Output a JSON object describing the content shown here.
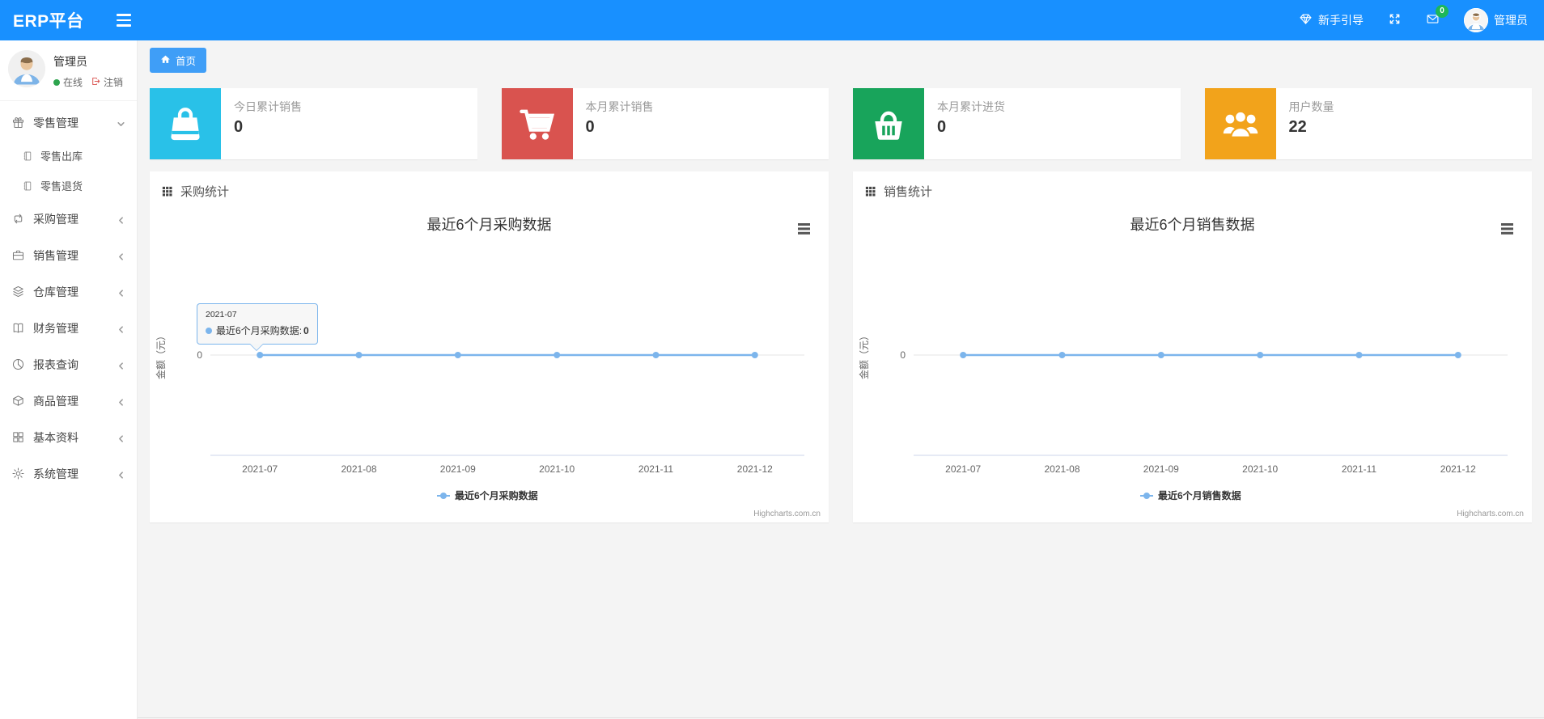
{
  "navbar": {
    "brand": "ERP平台",
    "guide_label": "新手引导",
    "message_count": "0",
    "username": "管理员",
    "color": "#1890ff",
    "badge_color": "#1db75a"
  },
  "sidebar": {
    "user": {
      "name": "管理员",
      "status": "在线",
      "logout_label": "注销"
    },
    "menu": [
      {
        "label": "零售管理",
        "icon": "gift-icon",
        "expanded": true,
        "children": [
          {
            "label": "零售出库",
            "icon": "journal-icon"
          },
          {
            "label": "零售退货",
            "icon": "journal-icon"
          }
        ]
      },
      {
        "label": "采购管理",
        "icon": "repeat-icon"
      },
      {
        "label": "销售管理",
        "icon": "briefcase-icon"
      },
      {
        "label": "仓库管理",
        "icon": "layers-icon"
      },
      {
        "label": "财务管理",
        "icon": "open-book-icon"
      },
      {
        "label": "报表查询",
        "icon": "pie-chart-icon"
      },
      {
        "label": "商品管理",
        "icon": "cube-icon"
      },
      {
        "label": "基本资料",
        "icon": "grid-icon"
      },
      {
        "label": "系统管理",
        "icon": "gear-icon"
      }
    ]
  },
  "tabs": {
    "home_label": "首页"
  },
  "stat_cards": [
    {
      "label": "今日累计销售",
      "value": "0",
      "icon": "shopping-bag-icon",
      "color": "#29c1e8"
    },
    {
      "label": "本月累计销售",
      "value": "0",
      "icon": "cart-icon",
      "color": "#d9534f"
    },
    {
      "label": "本月累计进货",
      "value": "0",
      "icon": "basket-icon",
      "color": "#18a45b"
    },
    {
      "label": "用户数量",
      "value": "22",
      "icon": "users-icon",
      "color": "#f2a31b"
    }
  ],
  "panels": [
    {
      "title": "采购统计"
    },
    {
      "title": "销售统计"
    }
  ],
  "chart_data": [
    {
      "type": "line",
      "title": "最近6个月采购数据",
      "categories": [
        "2021-07",
        "2021-08",
        "2021-09",
        "2021-10",
        "2021-11",
        "2021-12"
      ],
      "series": [
        {
          "name": "最近6个月采购数据",
          "values": [
            0,
            0,
            0,
            0,
            0,
            0
          ],
          "color": "#7cb5ec"
        }
      ],
      "xlabel": "",
      "ylabel": "金额（元）",
      "yticks": [
        "0"
      ],
      "ylim": [
        0,
        0
      ],
      "grid": "off",
      "legend_position": "bottom",
      "credit": "Highcharts.com.cn",
      "tooltip": {
        "header": "2021-07",
        "series_label": "最近6个月采购数据",
        "separator": ":",
        "value": "0",
        "point_index": 0
      }
    },
    {
      "type": "line",
      "title": "最近6个月销售数据",
      "categories": [
        "2021-07",
        "2021-08",
        "2021-09",
        "2021-10",
        "2021-11",
        "2021-12"
      ],
      "series": [
        {
          "name": "最近6个月销售数据",
          "values": [
            0,
            0,
            0,
            0,
            0,
            0
          ],
          "color": "#7cb5ec"
        }
      ],
      "xlabel": "",
      "ylabel": "金额（元）",
      "yticks": [
        "0"
      ],
      "ylim": [
        0,
        0
      ],
      "grid": "off",
      "legend_position": "bottom",
      "credit": "Highcharts.com.cn"
    }
  ]
}
